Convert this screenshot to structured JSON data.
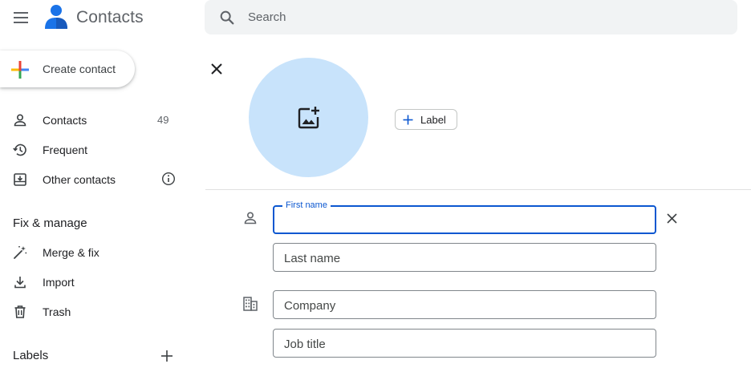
{
  "app": {
    "title": "Contacts",
    "menu_icon": "hamburger-menu-icon",
    "logo_icon": "person-logo-icon"
  },
  "search": {
    "placeholder": "Search",
    "value": ""
  },
  "sidebar": {
    "create_label": "Create contact",
    "nav": [
      {
        "label": "Contacts",
        "icon": "person-icon",
        "count": "49"
      },
      {
        "label": "Frequent",
        "icon": "history-icon"
      },
      {
        "label": "Other contacts",
        "icon": "inbox-download-icon"
      }
    ],
    "fix_manage_heading": "Fix & manage",
    "fix_manage": [
      {
        "label": "Merge & fix",
        "icon": "magic-wand-icon"
      },
      {
        "label": "Import",
        "icon": "download-icon"
      },
      {
        "label": "Trash",
        "icon": "trash-icon"
      }
    ],
    "labels_heading": "Labels"
  },
  "editor": {
    "label_button": "Label",
    "fields": {
      "first_name": {
        "label": "First name",
        "value": ""
      },
      "last_name": {
        "placeholder": "Last name",
        "value": ""
      },
      "company": {
        "placeholder": "Company",
        "value": ""
      },
      "job_title": {
        "placeholder": "Job title",
        "value": ""
      }
    }
  },
  "colors": {
    "accent_blue": "#0b57d0",
    "avatar_bg": "#c8e3fb",
    "search_bg": "#f1f3f4",
    "logo_blue": "#1a73e8"
  }
}
